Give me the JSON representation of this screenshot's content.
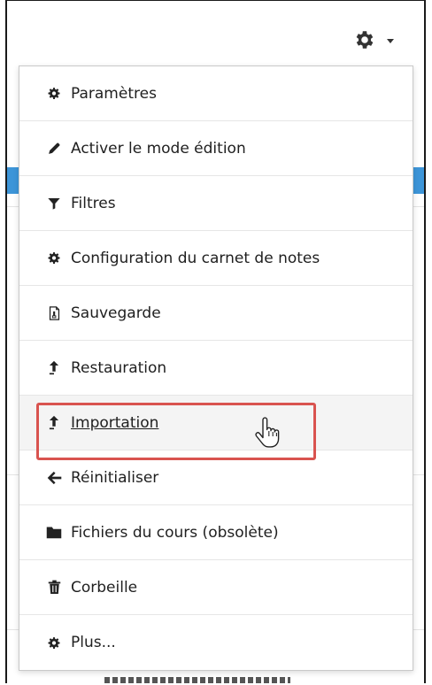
{
  "menu": {
    "items": [
      {
        "label": "Paramètres",
        "icon": "gear-icon"
      },
      {
        "label": "Activer le mode édition",
        "icon": "pencil-icon"
      },
      {
        "label": "Filtres",
        "icon": "filter-icon"
      },
      {
        "label": "Configuration du carnet de notes",
        "icon": "gear-icon"
      },
      {
        "label": "Sauvegarde",
        "icon": "backup-file-icon"
      },
      {
        "label": "Restauration",
        "icon": "upload-arrow-icon"
      },
      {
        "label": "Importation",
        "icon": "upload-arrow-icon",
        "hovered": true
      },
      {
        "label": "Réinitialiser",
        "icon": "arrow-left-icon"
      },
      {
        "label": "Fichiers du cours (obsolète)",
        "icon": "folder-icon"
      },
      {
        "label": "Corbeille",
        "icon": "trash-icon"
      },
      {
        "label": "Plus...",
        "icon": "gear-icon"
      }
    ]
  },
  "colors": {
    "highlight": "#d9534f",
    "accent_strip": "#3d95d8",
    "text": "#1f1f1f"
  }
}
